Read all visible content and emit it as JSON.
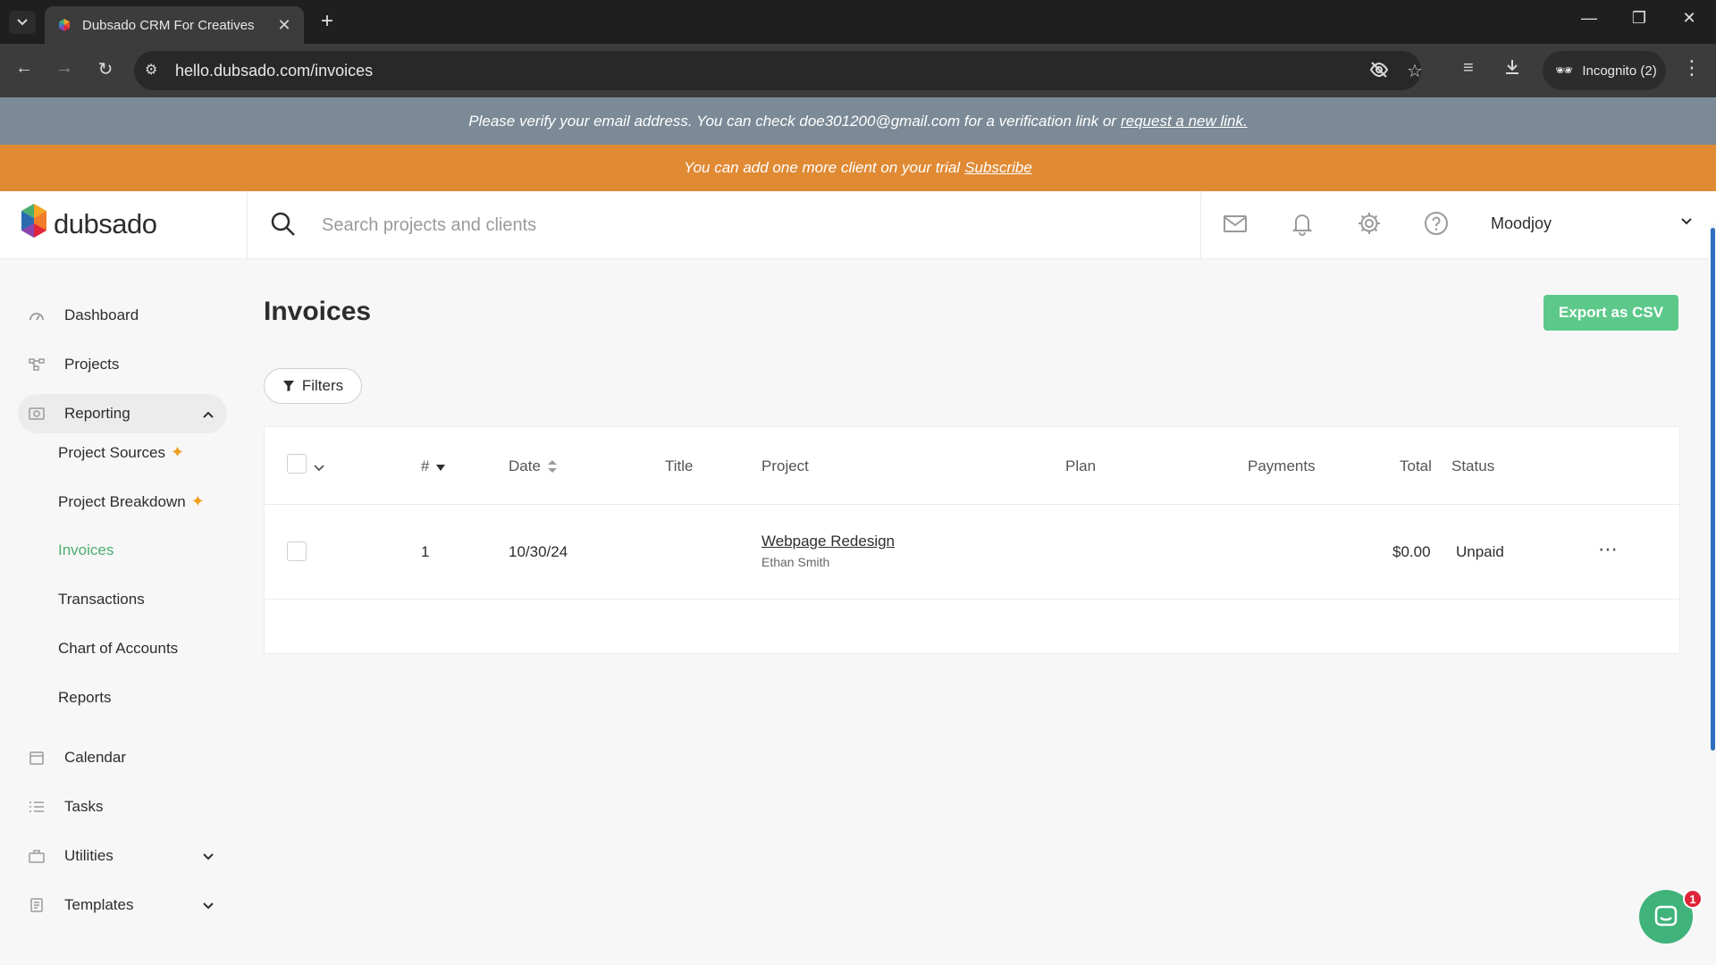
{
  "browser": {
    "tab_title": "Dubsado CRM For Creatives",
    "url": "hello.dubsado.com/invoices",
    "incognito_label": "Incognito (2)"
  },
  "banners": {
    "verify_text": "Please verify your email address. You can check doe301200@gmail.com for a verification link or",
    "verify_link": "request a new link.",
    "trial_text": "You can add one more client on your trial",
    "trial_link": "Subscribe"
  },
  "header": {
    "logo_text": "dubsado",
    "search_placeholder": "Search projects and clients",
    "account_name": "Moodjoy"
  },
  "sidebar": {
    "items": [
      {
        "label": "Dashboard",
        "icon": "dashboard-icon"
      },
      {
        "label": "Projects",
        "icon": "projects-icon"
      },
      {
        "label": "Reporting",
        "icon": "reporting-icon",
        "expanded": true
      },
      {
        "label": "Calendar",
        "icon": "calendar-icon"
      },
      {
        "label": "Tasks",
        "icon": "tasks-icon"
      },
      {
        "label": "Utilities",
        "icon": "utilities-icon"
      },
      {
        "label": "Templates",
        "icon": "templates-icon"
      }
    ],
    "reporting_sub": [
      {
        "label": "Project Sources",
        "new": true
      },
      {
        "label": "Project Breakdown",
        "new": true
      },
      {
        "label": "Invoices",
        "current": true
      },
      {
        "label": "Transactions"
      },
      {
        "label": "Chart of Accounts"
      },
      {
        "label": "Reports"
      }
    ]
  },
  "main": {
    "title": "Invoices",
    "export_label": "Export as CSV",
    "filters_label": "Filters",
    "table": {
      "columns": [
        "#",
        "Date",
        "Title",
        "Project",
        "Plan",
        "Payments",
        "Total",
        "Status"
      ],
      "rows": [
        {
          "number": "1",
          "date": "10/30/24",
          "title": "",
          "project": "Webpage Redesign",
          "client": "Ethan Smith",
          "plan": "",
          "payments": "",
          "total": "$0.00",
          "status": "Unpaid"
        }
      ]
    }
  },
  "chat": {
    "badge_count": "1"
  },
  "colors": {
    "accent_green": "#5cc98a",
    "verify_banner": "#7b8a96",
    "trial_banner": "#e08a34",
    "current_nav": "#4cae6e"
  }
}
